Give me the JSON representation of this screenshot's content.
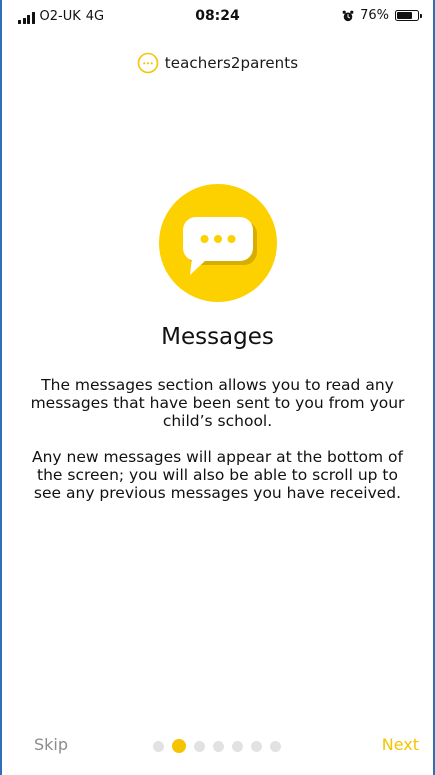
{
  "status_bar": {
    "carrier": "O2-UK",
    "network": "4G",
    "time": "08:24",
    "battery": "76%",
    "battery_level": 0.76,
    "icons": [
      "signal-icon",
      "alarm-icon",
      "battery-icon"
    ]
  },
  "header": {
    "brand": "teachers2parents",
    "logo_icon": "speech-bubble-dots-icon"
  },
  "onboarding": {
    "hero_icon": "message-bubble-icon",
    "title": "Messages",
    "paragraph_1": "The messages section allows you to read any messages that have been sent to you from your child’s school.",
    "paragraph_2": "Any new messages will appear at the bottom of the screen; you will also be able to scroll up to see any previous messages you have received."
  },
  "footer": {
    "skip_label": "Skip",
    "next_label": "Next",
    "page_count": 7,
    "current_page": 2
  },
  "colors": {
    "accent": "#f5c400",
    "hero_circle": "#fdd000",
    "bubble_shadow": "#d9ad00",
    "muted_text": "#8c8c8c",
    "inactive_dot": "#e2e2e2",
    "frame_border": "#2f6fb7"
  }
}
